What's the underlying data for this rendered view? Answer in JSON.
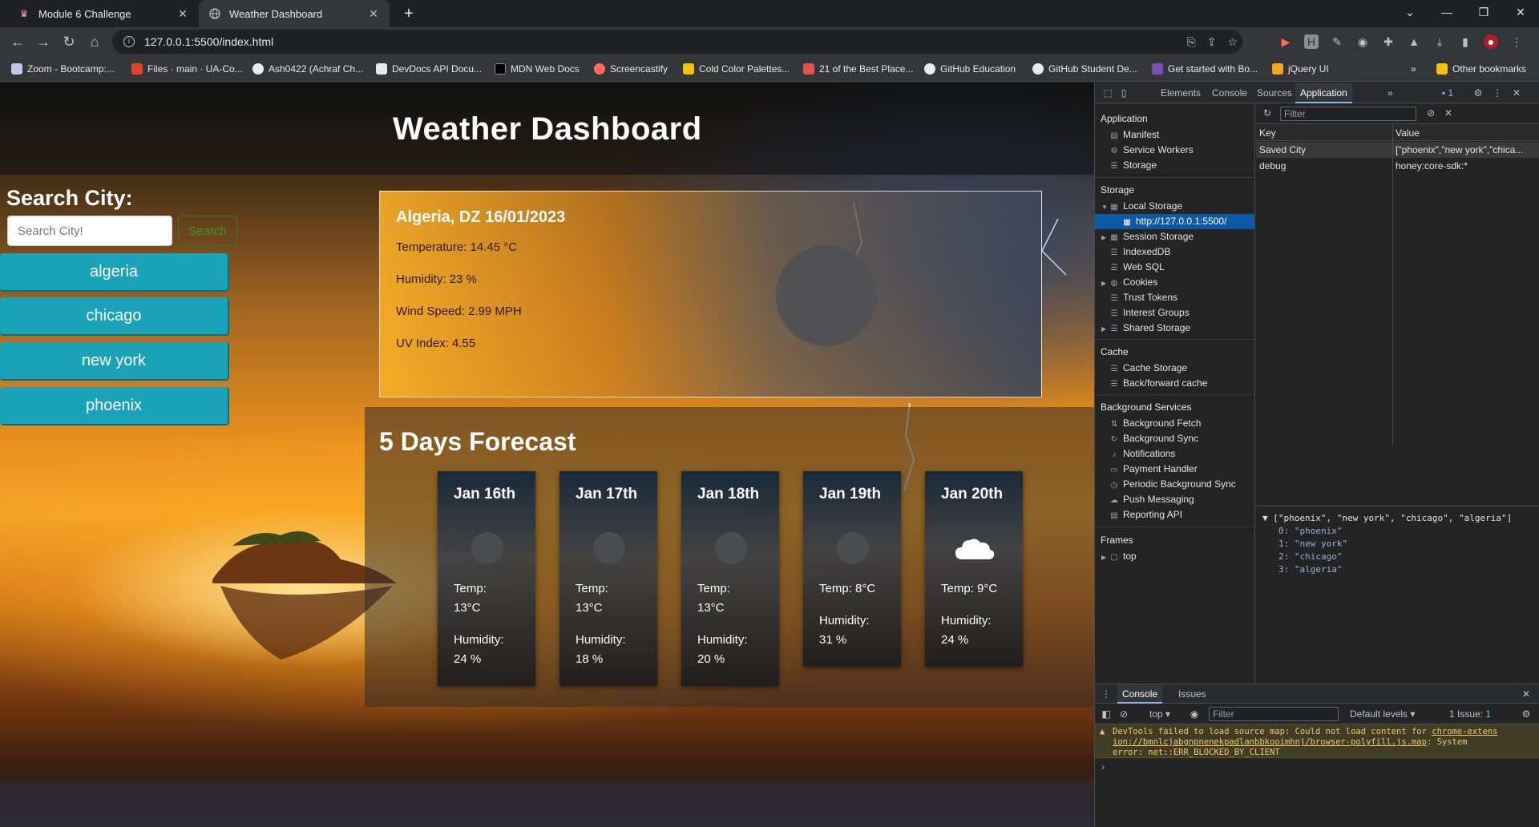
{
  "browser": {
    "tabs": [
      {
        "title": "Module 6 Challenge",
        "icon": "github-classroom-icon"
      },
      {
        "title": "Weather Dashboard",
        "icon": "globe-icon"
      }
    ],
    "url": "127.0.0.1:5500/index.html",
    "bookmarks": [
      "Zoom - Bootcamp:...",
      "Files · main · UA-Co...",
      "Ash0422 (Achraf Ch...",
      "DevDocs API Docu...",
      "MDN Web Docs",
      "Screencastify",
      "Cold Color Palettes...",
      "21 of the Best Place...",
      "GitHub Education",
      "GitHub Student De...",
      "Get started with Bo...",
      "jQuery UI"
    ],
    "other_bookmarks": "Other bookmarks",
    "overflow": "»"
  },
  "page": {
    "title": "Weather Dashboard",
    "search_label": "Search City:",
    "search_placeholder": "Search City!",
    "search_button": "Search",
    "cities": [
      "algeria",
      "chicago",
      "new york",
      "phoenix"
    ],
    "current": {
      "heading": "Algeria, DZ 16/01/2023",
      "temperature": "Temperature: 14.45 °C",
      "humidity": "Humidity: 23 %",
      "wind": "Wind Speed: 2.99 MPH",
      "uv": "UV Index: 4.55"
    },
    "forecast_title": "5 Days Forecast",
    "forecast": [
      {
        "date": "Jan 16th",
        "temp_label": "Temp:",
        "temp_value": "13°C",
        "humidity_label": "Humidity:",
        "humidity_value": "24 %",
        "icon": "missing-icon"
      },
      {
        "date": "Jan 17th",
        "temp_label": "Temp:",
        "temp_value": "13°C",
        "humidity_label": "Humidity:",
        "humidity_value": "18 %",
        "icon": "missing-icon"
      },
      {
        "date": "Jan 18th",
        "temp_label": "Temp:",
        "temp_value": "13°C",
        "humidity_label": "Humidity:",
        "humidity_value": "20 %",
        "icon": "missing-icon"
      },
      {
        "date": "Jan 19th",
        "temp_label": "Temp: 8°C",
        "humidity_label": "Humidity:",
        "humidity_value": "31 %",
        "icon": "missing-icon"
      },
      {
        "date": "Jan 20th",
        "temp_label": "Temp: 9°C",
        "humidity_label": "Humidity:",
        "humidity_value": "24 %",
        "icon": "cloud-icon"
      }
    ]
  },
  "devtools": {
    "tabs": [
      "Elements",
      "Console",
      "Sources",
      "Application"
    ],
    "selected_tab": "Application",
    "more": "»",
    "issues_badge": "1",
    "sidebar": {
      "application_head": "Application",
      "application_items": [
        "Manifest",
        "Service Workers",
        "Storage"
      ],
      "storage_head": "Storage",
      "storage_items": [
        "Local Storage",
        "http://127.0.0.1:5500/",
        "Session Storage",
        "IndexedDB",
        "Web SQL",
        "Cookies",
        "Trust Tokens",
        "Interest Groups",
        "Shared Storage"
      ],
      "cache_head": "Cache",
      "cache_items": [
        "Cache Storage",
        "Back/forward cache"
      ],
      "bg_head": "Background Services",
      "bg_items": [
        "Background Fetch",
        "Background Sync",
        "Notifications",
        "Payment Handler",
        "Periodic Background Sync",
        "Push Messaging",
        "Reporting API"
      ],
      "frames_head": "Frames",
      "frames_items": [
        "top"
      ]
    },
    "filter_placeholder": "Filter",
    "table": {
      "key_header": "Key",
      "value_header": "Value",
      "rows": [
        {
          "key": "Saved City",
          "value": "[\"phoenix\",\"new york\",\"chica..."
        },
        {
          "key": "debug",
          "value": "honey:core-sdk:*"
        }
      ]
    },
    "preview": {
      "summary": "[\"phoenix\", \"new york\", \"chicago\", \"algeria\"]",
      "items": [
        "0: \"phoenix\"",
        "1: \"new york\"",
        "2: \"chicago\"",
        "3: \"algeria\""
      ]
    },
    "drawer": {
      "tabs": [
        "Console",
        "Issues"
      ],
      "context": "top",
      "filter_placeholder": "Filter",
      "levels": "Default levels",
      "issues": "1 Issue:",
      "issues_count": "1",
      "warning_line1_a": "DevTools failed to load source map: Could not load content for ",
      "warning_link1": "chrome-extens",
      "warning_link2": "ion://bmnlcjabgnpnenekpadlanbbkooimhnj/browser-polyfill.js.map",
      "warning_line2_b": ": System",
      "warning_line3": "error: net::ERR_BLOCKED_BY_CLIENT",
      "prompt": "›"
    }
  }
}
